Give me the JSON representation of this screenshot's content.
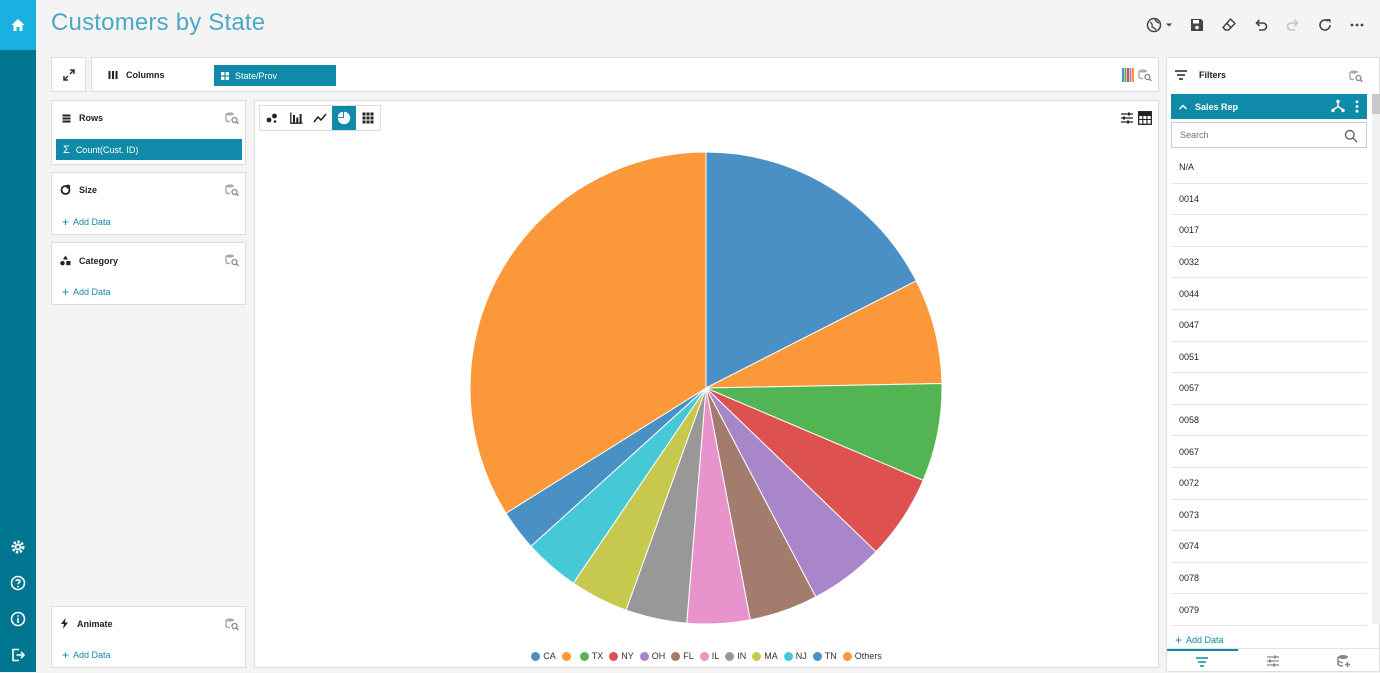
{
  "app": {
    "title": "Customers by State"
  },
  "nav": {
    "home_icon": "home-icon",
    "bottom_icons": [
      "gear-icon",
      "help-icon",
      "info-icon",
      "logout-icon"
    ]
  },
  "toolbar": {
    "icons": [
      "globe-icon",
      "save-icon",
      "eraser-icon",
      "undo-icon",
      "redo-icon",
      "refresh-icon",
      "more-icon"
    ]
  },
  "columns": {
    "label": "Columns",
    "pill": "State/Prov"
  },
  "rows": {
    "label": "Rows",
    "pill": "Count(Cust. ID)"
  },
  "size": {
    "label": "Size",
    "add": "Add Data"
  },
  "category": {
    "label": "Category",
    "add": "Add Data"
  },
  "animate": {
    "label": "Animate",
    "add": "Add Data"
  },
  "chart_types": [
    "scatter",
    "bar",
    "line",
    "pie",
    "grid"
  ],
  "filters": {
    "label": "Filters",
    "sales_rep": "Sales Rep",
    "search_placeholder": "Search",
    "items": [
      "N/A",
      "0014",
      "0017",
      "0032",
      "0044",
      "0047",
      "0051",
      "0057",
      "0058",
      "0067",
      "0072",
      "0073",
      "0074",
      "0078",
      "0079"
    ],
    "add": "Add Data"
  },
  "chart_data": {
    "type": "pie",
    "slices": [
      {
        "label": "CA",
        "value": 17.5,
        "color": "#4a90c4"
      },
      {
        "label": "",
        "value": 7.2,
        "color": "#fb983a"
      },
      {
        "label": "TX",
        "value": 6.7,
        "color": "#53b453"
      },
      {
        "label": "NY",
        "value": 5.8,
        "color": "#de5151"
      },
      {
        "label": "OH",
        "value": 5.1,
        "color": "#a886c9"
      },
      {
        "label": "FL",
        "value": 4.7,
        "color": "#a47c6e"
      },
      {
        "label": "IL",
        "value": 4.3,
        "color": "#e893cb"
      },
      {
        "label": "IN",
        "value": 4.2,
        "color": "#989898"
      },
      {
        "label": "MA",
        "value": 4.0,
        "color": "#c7c84e"
      },
      {
        "label": "NJ",
        "value": 3.8,
        "color": "#47c8d7"
      },
      {
        "label": "TN",
        "value": 2.8,
        "color": "#4a90c4"
      },
      {
        "label": "Others",
        "value": 33.9,
        "color": "#fb983a"
      }
    ]
  }
}
